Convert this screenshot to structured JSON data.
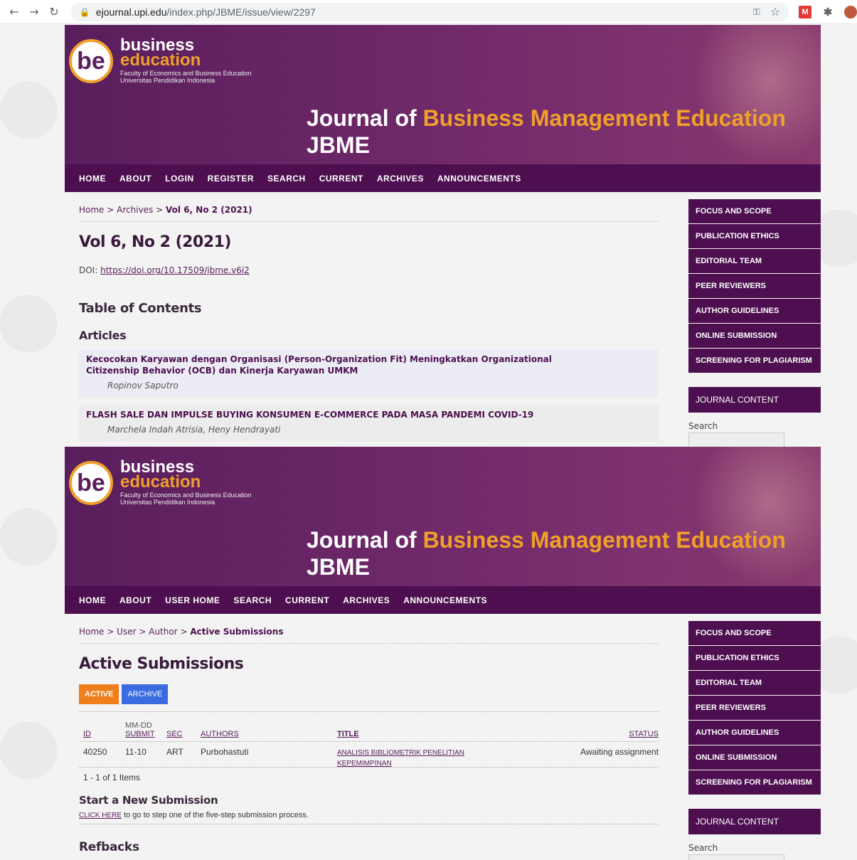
{
  "browser": {
    "url_host": "ejournal.upi.edu",
    "url_path": "/index.php/JBME/issue/view/2297",
    "icons": [
      "back-icon",
      "forward-icon",
      "reload-icon",
      "lock-icon",
      "key-icon",
      "star-icon",
      "extension-icon",
      "puzzle-icon",
      "profile-icon"
    ]
  },
  "header": {
    "logo_mark": "be",
    "logo_line1": "business",
    "logo_line2": "education",
    "logo_line3": "Faculty of Economics and Business Education",
    "logo_line4": "Universitas Pendidikan Indonesia",
    "title_part1": "Journal of",
    "title_part2": "Business Management Education",
    "title_short": "JBME",
    "accent": "#f0a02a",
    "brand": "#4d0f4f"
  },
  "top": {
    "nav": [
      "HOME",
      "ABOUT",
      "LOGIN",
      "REGISTER",
      "SEARCH",
      "CURRENT",
      "ARCHIVES",
      "ANNOUNCEMENTS"
    ],
    "breadcrumb": {
      "home": "Home",
      "sep": ">",
      "archives": "Archives",
      "current": "Vol 6, No 2 (2021)"
    },
    "heading": "Vol 6, No 2 (2021)",
    "doi_label": "DOI:",
    "doi_link": "https://doi.org/10.17509/jbme.v6i2",
    "toc": "Table of Contents",
    "section": "Articles",
    "articles": [
      {
        "title_line1": "Kecocokan Karyawan dengan Organisasi (Person-Organization Fit) Meningkatkan Organizational",
        "title_line2": "Citizenship Behavior (OCB) dan Kinerja Karyawan UMKM",
        "authors": "Ropinov Saputro"
      },
      {
        "title_line1": "FLASH SALE DAN IMPULSE BUYING KONSUMEN E-COMMERCE PADA MASA PANDEMI COVID-19",
        "title_line2": "",
        "authors": "Marchela Indah Atrisia, Heny Hendrayati"
      }
    ]
  },
  "sidebar": {
    "links": [
      "FOCUS AND SCOPE",
      "PUBLICATION ETHICS",
      "EDITORIAL TEAM",
      "PEER REVIEWERS",
      "AUTHOR GUIDELINES",
      "ONLINE SUBMISSION",
      "SCREENING FOR PLAGIARISM"
    ],
    "journal_content": "JOURNAL CONTENT",
    "search_label": "Search"
  },
  "bottom": {
    "nav": [
      "HOME",
      "ABOUT",
      "USER HOME",
      "SEARCH",
      "CURRENT",
      "ARCHIVES",
      "ANNOUNCEMENTS"
    ],
    "breadcrumb": {
      "home": "Home",
      "sep": ">",
      "user": "User",
      "author": "Author",
      "current": "Active Submissions"
    },
    "heading": "Active Submissions",
    "tab_active": "ACTIVE",
    "tab_archive": "ARCHIVE",
    "columns": {
      "id": "ID",
      "date_top": "MM-DD",
      "date": "SUBMIT",
      "sec": "SEC",
      "authors": "AUTHORS",
      "title": "TITLE",
      "status": "STATUS"
    },
    "rows": [
      {
        "id": "40250",
        "date": "11-10",
        "sec": "ART",
        "authors": "Purbohastuti",
        "title_line1": "ANALISIS BIBLIOMETRIK PENELITIAN",
        "title_line2": "KEPEMIMPINAN",
        "status": "Awaiting assignment"
      }
    ],
    "items_count": "1 - 1 of 1 Items",
    "new_sub_heading": "Start a New Submission",
    "new_sub_link": "CLICK HERE",
    "new_sub_text": " to go to step one of the five-step submission process.",
    "refbacks": "Refbacks"
  }
}
